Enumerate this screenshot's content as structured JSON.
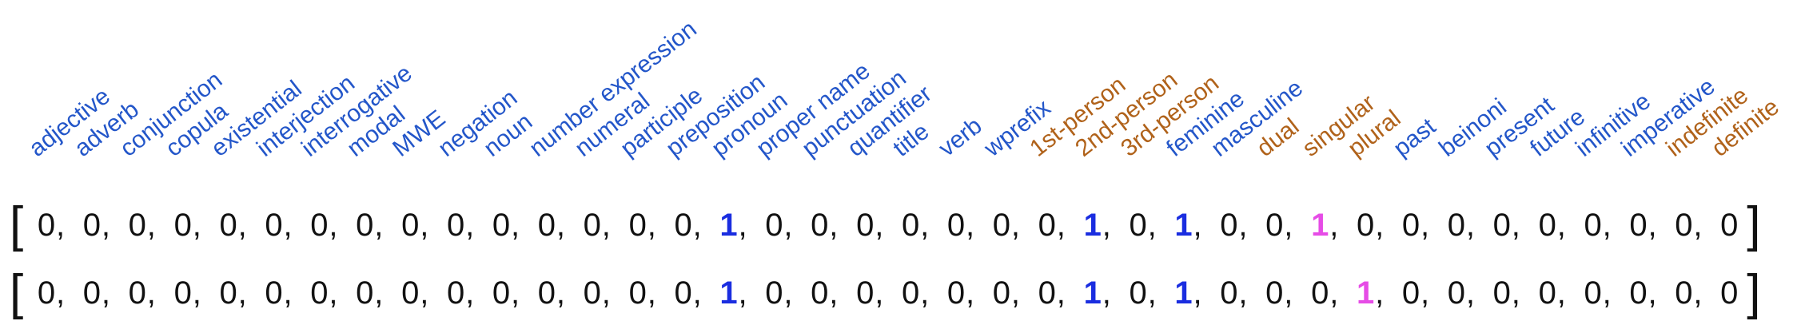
{
  "colors": {
    "blue_label": "#2356c9",
    "orange_label": "#b0621a",
    "blue_one": "#1a2de0",
    "magenta_one": "#e64ce6",
    "text": "#111111"
  },
  "labels": [
    {
      "text": "adjective",
      "color": "blue"
    },
    {
      "text": "adverb",
      "color": "blue"
    },
    {
      "text": "conjunction",
      "color": "blue"
    },
    {
      "text": "copula",
      "color": "blue"
    },
    {
      "text": "existential",
      "color": "blue"
    },
    {
      "text": "interjection",
      "color": "blue"
    },
    {
      "text": "interrogative",
      "color": "blue"
    },
    {
      "text": "modal",
      "color": "blue"
    },
    {
      "text": "MWE",
      "color": "blue"
    },
    {
      "text": "negation",
      "color": "blue"
    },
    {
      "text": "noun",
      "color": "blue"
    },
    {
      "text": "number expression",
      "color": "blue"
    },
    {
      "text": "numeral",
      "color": "blue"
    },
    {
      "text": "participle",
      "color": "blue"
    },
    {
      "text": "preposition",
      "color": "blue"
    },
    {
      "text": "pronoun",
      "color": "blue"
    },
    {
      "text": "proper name",
      "color": "blue"
    },
    {
      "text": "punctuation",
      "color": "blue"
    },
    {
      "text": "quantifier",
      "color": "blue"
    },
    {
      "text": "title",
      "color": "blue"
    },
    {
      "text": "verb",
      "color": "blue"
    },
    {
      "text": "wprefix",
      "color": "blue"
    },
    {
      "text": "1st-person",
      "color": "orange"
    },
    {
      "text": "2nd-person",
      "color": "orange"
    },
    {
      "text": "3rd-person",
      "color": "orange"
    },
    {
      "text": "feminine",
      "color": "blue"
    },
    {
      "text": "masculine",
      "color": "blue"
    },
    {
      "text": "dual",
      "color": "orange"
    },
    {
      "text": "singular",
      "color": "orange"
    },
    {
      "text": "plural",
      "color": "orange"
    },
    {
      "text": "past",
      "color": "blue"
    },
    {
      "text": "beinoni",
      "color": "blue"
    },
    {
      "text": "present",
      "color": "blue"
    },
    {
      "text": "future",
      "color": "blue"
    },
    {
      "text": "infinitive",
      "color": "blue"
    },
    {
      "text": "imperative",
      "color": "blue"
    },
    {
      "text": "indefinite",
      "color": "orange"
    },
    {
      "text": "definite",
      "color": "orange"
    }
  ],
  "vectors": [
    {
      "open_bracket": "[",
      "close_bracket": "]",
      "values": [
        "0",
        "0",
        "0",
        "0",
        "0",
        "0",
        "0",
        "0",
        "0",
        "0",
        "0",
        "0",
        "0",
        "0",
        "0",
        "1",
        "0",
        "0",
        "0",
        "0",
        "0",
        "0",
        "0",
        "1",
        "0",
        "1",
        "0",
        "0",
        "1",
        "0",
        "0",
        "0",
        "0",
        "0",
        "0",
        "0",
        "0",
        "0"
      ],
      "highlights": {
        "15": "blue",
        "23": "blue",
        "25": "blue",
        "28": "magenta"
      }
    },
    {
      "open_bracket": "[",
      "close_bracket": "]",
      "values": [
        "0",
        "0",
        "0",
        "0",
        "0",
        "0",
        "0",
        "0",
        "0",
        "0",
        "0",
        "0",
        "0",
        "0",
        "0",
        "1",
        "0",
        "0",
        "0",
        "0",
        "0",
        "0",
        "0",
        "1",
        "0",
        "1",
        "0",
        "0",
        "0",
        "1",
        "0",
        "0",
        "0",
        "0",
        "0",
        "0",
        "0",
        "0"
      ],
      "highlights": {
        "15": "blue",
        "23": "blue",
        "25": "blue",
        "29": "magenta"
      }
    }
  ],
  "separator": ","
}
